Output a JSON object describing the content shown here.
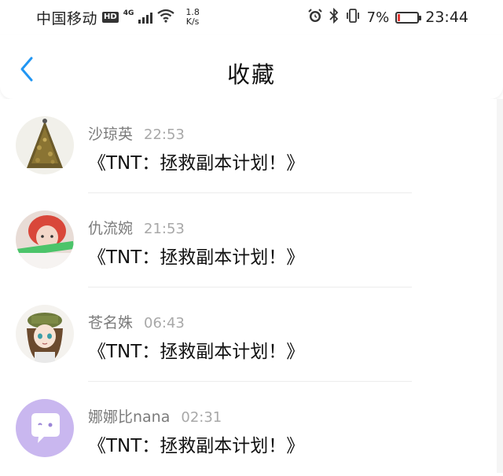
{
  "status_bar": {
    "carrier": "中国移动",
    "hd": "HD",
    "network": "4G",
    "speed_value": "1.8",
    "speed_unit": "K/s",
    "battery_percent": "7%",
    "battery_level": 0.07,
    "time": "23:44"
  },
  "header": {
    "title": "收藏",
    "back_icon": "chevron-left-icon"
  },
  "colors": {
    "accent": "#2196f3",
    "username": "#7b7b7b",
    "timestamp": "#a8a8a8",
    "battery_low": "#e53935"
  },
  "items": [
    {
      "user": "沙琼英",
      "time": "22:53",
      "message": "《TNT：拯救副本计划！》",
      "avatar": "christmas-tree-avatar"
    },
    {
      "user": "仇流婉",
      "time": "21:53",
      "message": "《TNT：拯救副本计划！》",
      "avatar": "red-hair-boy-avatar"
    },
    {
      "user": "苍名姝",
      "time": "06:43",
      "message": "《TNT：拯救副本计划！》",
      "avatar": "anime-girl-avatar"
    },
    {
      "user": "娜娜比nana",
      "time": "02:31",
      "message": "《TNT：拯救副本计划！》",
      "avatar": "purple-chat-bubble-avatar"
    }
  ]
}
